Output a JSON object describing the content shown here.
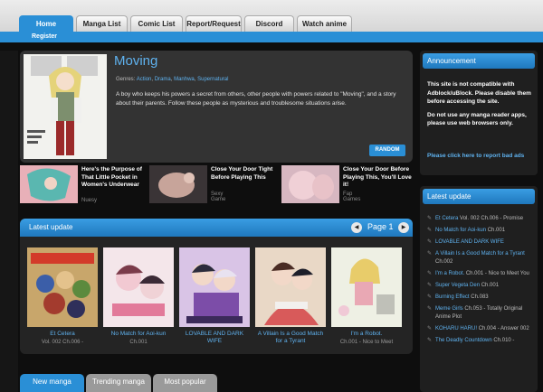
{
  "nav": {
    "tabs": [
      "Home",
      "Manga List",
      "Comic List",
      "Report/Request",
      "Discord",
      "Watch anime"
    ],
    "register": "Register"
  },
  "featured": {
    "title": "Moving",
    "genres_label": "Genres:",
    "genres": [
      "Action",
      "Drama",
      "Manhwa",
      "Supernatural"
    ],
    "description": "A boy who keeps his powers a secret from others, other people with powers related to \"Moving\", and a story about their parents. Follow these people as mysterious and troublesome situations arise.",
    "random_label": "RANDOM"
  },
  "recommendations": [
    {
      "title": "Here's the Purpose of That Little Pocket in Women's Underwear",
      "source": "Nuesy"
    },
    {
      "title": "Close Your Door Tight Before Playing This",
      "source": "Sexy Game"
    },
    {
      "title": "Close Your Door Before Playing This, You'll Love it!",
      "source": "Fap Games"
    }
  ],
  "latest_update": {
    "title": "Latest update",
    "page_label": "Page 1",
    "items": [
      {
        "title": "Et Cetera",
        "chapter": "Vol. 002 Ch.006 -"
      },
      {
        "title": "No Match for Aoi-kun",
        "chapter": "Ch.001"
      },
      {
        "title": "LOVABLE AND DARK WIFE",
        "chapter": ""
      },
      {
        "title": "A Villain Is a Good Match for a Tyrant",
        "chapter": ""
      },
      {
        "title": "I'm a Robot.",
        "chapter": "Ch.001 - Nice to Meet"
      }
    ]
  },
  "bottom_tabs": [
    "New manga",
    "Trending manga",
    "Most popular"
  ],
  "sidebar": {
    "announcement_title": "Announcement",
    "announcement_paragraphs": [
      "This site is not compatible with Adblock/uBlock. Please disable them before accessing the site.",
      "Do not use any manga reader apps, please use web browsers only."
    ],
    "report_link": "Please click here to report bad ads",
    "latest_title": "Latest update",
    "latest_items": [
      {
        "title": "Et Cetera",
        "chapter": "Vol. 002 Ch.006 - Promise"
      },
      {
        "title": "No Match for Aoi-kun",
        "chapter": "Ch.001"
      },
      {
        "title": "LOVABLE AND DARK WIFE",
        "chapter": ""
      },
      {
        "title": "A Villain Is a Good Match for a Tyrant",
        "chapter": "Ch.002"
      },
      {
        "title": "I'm a Robot.",
        "chapter": "Ch.001 - Nice to Meet You"
      },
      {
        "title": "Super Vegeta Den",
        "chapter": "Ch.001"
      },
      {
        "title": "Burning Effect",
        "chapter": "Ch.083"
      },
      {
        "title": "Meme Girls",
        "chapter": "Ch.053 - Totally Original Anime Plot"
      },
      {
        "title": "KOHARU HARU!",
        "chapter": "Ch.004 - Answer 002"
      },
      {
        "title": "The Deadly Countdown",
        "chapter": "Ch.010 -"
      }
    ]
  },
  "colors": {
    "accent": "#2a8fd6",
    "link": "#5fb2ef",
    "background": "#0e0e0e",
    "panel": "#333333"
  }
}
